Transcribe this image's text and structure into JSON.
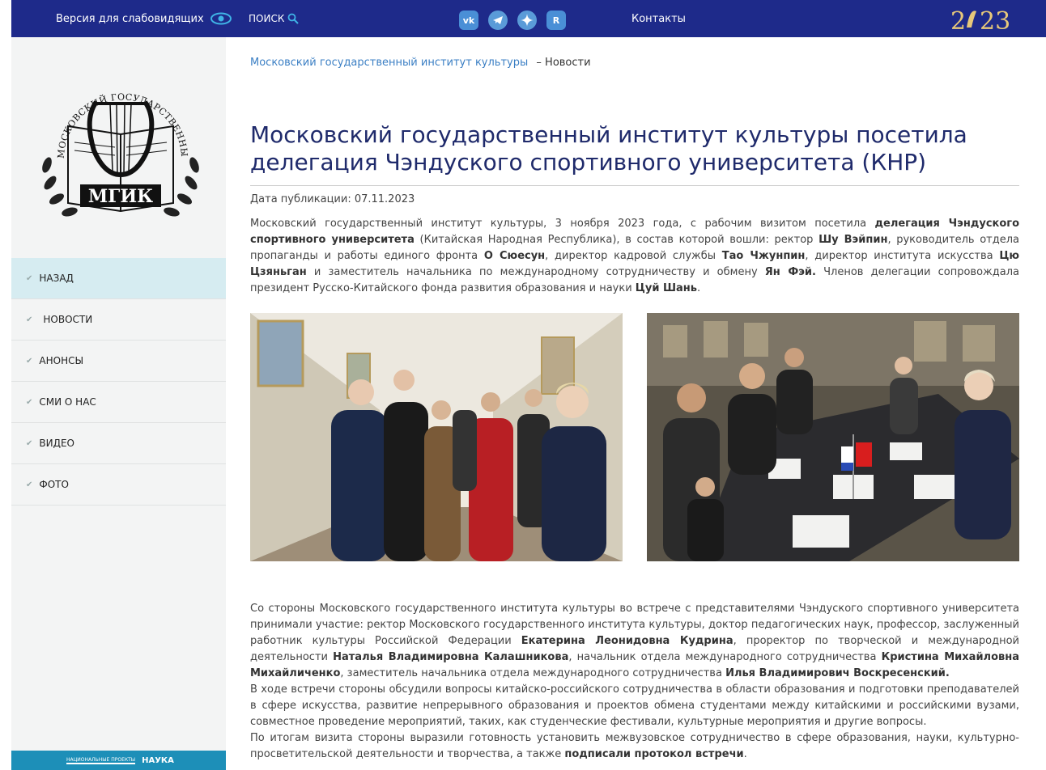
{
  "topbar": {
    "vision_label": "Версия для слабовидящих",
    "search_label": "ПОИСК",
    "contacts_label": "Контакты",
    "socials": [
      "VK",
      "Telegram",
      "Dzen",
      "Rutube"
    ],
    "bg_color": "#1e2a8a"
  },
  "sidebar": {
    "logo_text": "МГИК",
    "logo_ring_text": "МОСКОВСКИЙ ГОСУДАРСТВЕННЫЙ ИНСТИТУТ КУЛЬТУРЫ",
    "menu": [
      {
        "label": "НАЗАД",
        "active": true
      },
      {
        "label": "НОВОСТИ",
        "active": false
      },
      {
        "label": "АНОНСЫ",
        "active": false
      },
      {
        "label": "СМИ О НАС",
        "active": false
      },
      {
        "label": "ВИДЕО",
        "active": false
      },
      {
        "label": "ФОТО",
        "active": false
      }
    ],
    "banner_small": "НАЦИОНАЛЬНЫЕ ПРОЕКТЫ",
    "banner_label": "НАУКА"
  },
  "breadcrumb": {
    "home": "Московский государственный институт культуры",
    "current": "– Новости"
  },
  "article": {
    "title": "Московский государственный институт культуры посетила делегация Чэндуского спортивного университета (КНР)",
    "date": "Дата публикации: 07.11.2023",
    "p1": [
      " Московский государственный институт культуры, 3 ноября 2023 года, с рабочим визитом посетила ",
      "делегация Чэндуского спортивного университета",
      " (Китайская Народная Республика), в состав которой вошли: ректор ",
      "Шу Вэйпин",
      ", руководитель отдела пропаганды и работы единого фронта ",
      "О Сюесун",
      ", директор кадровой службы ",
      "Тао Чжунпин",
      ", директор института искусства ",
      "Цю Цзяньган",
      " и заместитель начальника по международному сотрудничеству и обмену ",
      "Ян Фэй.",
      " Членов делегации сопровождала президент Русско-Китайского фонда развития образования и науки ",
      "Цуй Шань",
      "."
    ],
    "p2": [
      " Со стороны Московского государственного института культуры во встрече с представителями Чэндуского спортивного университета принимали участие: ректор Московского государственного института культуры, доктор педагогических наук, профессор, заслуженный работник культуры Российской Федерации ",
      "Екатерина Леонидовна Кудрина",
      ", проректор по творческой и международной деятельности ",
      "Наталья Владимировна Калашникова",
      ", начальник отдела международного сотрудничества ",
      "Кристина Михайловна Михайличенко",
      ", заместитель начальника отдела международного сотрудничества ",
      "Илья Владимирович Воскресенский."
    ],
    "p3": " В ходе встречи стороны обсудили вопросы китайско-российского сотрудничества в области образования и подготовки преподавателей в сфере искусства, развитие непрерывного образования и проектов обмена студентами между китайскими и российскими вузами, совместное проведение мероприятий, таких, как студенческие фестивали, культурные мероприятия и другие вопросы.",
    "p4": [
      "  По итогам визита стороны выразили готовность установить межвузовское сотрудничество в сфере образования, науки, культурно-просветительской деятельности и творчества, а также ",
      "подписали протокол встречи",
      "."
    ]
  }
}
